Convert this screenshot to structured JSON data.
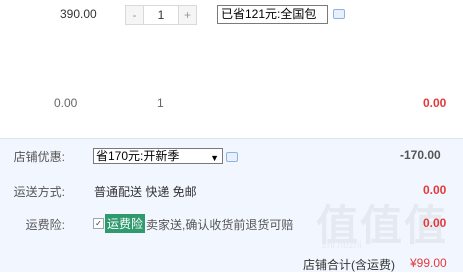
{
  "item": {
    "price": "390.00",
    "qty_minus": "-",
    "qty_value": "1",
    "qty_plus": "+",
    "promotion": "已省121元:全国包"
  },
  "item2": {
    "price": "0.00",
    "qty": "1",
    "total": "0.00"
  },
  "shop": {
    "discount_label": "店铺优惠:",
    "discount_value": "省170元:开新季",
    "discount_arrow": "▼",
    "discount_amount": "-170.00",
    "shipping_label": "运送方式:",
    "shipping_value": "普通配送 快递 免邮",
    "shipping_amount": "0.00",
    "insurance_label": "运费险:",
    "insurance_check": "✓",
    "insurance_tag": "运费险",
    "insurance_desc": "卖家送,确认收货前退货可赔",
    "insurance_amount": "0.00",
    "total_label": "店铺合计(含运费)",
    "total_amount": "¥99.00"
  },
  "watermark": {
    "main": "值值值",
    "sub": "zhi.hbzhi"
  }
}
